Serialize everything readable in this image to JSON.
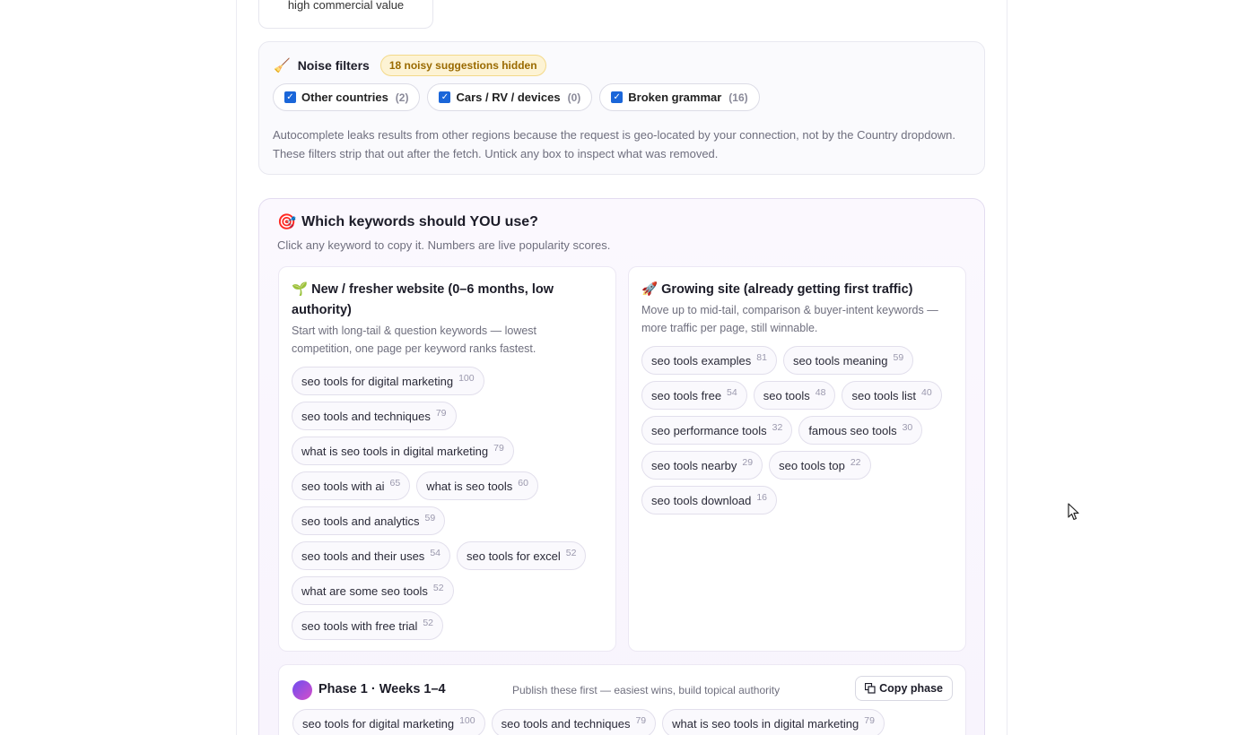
{
  "prev_card": {
    "text": "high commercial value"
  },
  "noise": {
    "icon": "broom-icon",
    "title": "Noise filters",
    "badge": "18 noisy suggestions hidden",
    "filters": [
      {
        "label": "Other countries",
        "count": "(2)",
        "checked": true
      },
      {
        "label": "Cars / RV / devices",
        "count": "(0)",
        "checked": true
      },
      {
        "label": "Broken grammar",
        "count": "(16)",
        "checked": true
      }
    ],
    "note": "Autocomplete leaks results from other regions because the request is geo-located by your connection, not by the Country dropdown. These filters strip that out after the fetch. Untick any box to inspect what was removed."
  },
  "which": {
    "icon": "target-icon",
    "title": "Which keywords should YOU use?",
    "subtitle": "Click any keyword to copy it. Numbers are live popularity scores.",
    "columns": [
      {
        "icon": "seedling-icon",
        "title": "New / fresher website (0–6 months, low authority)",
        "desc": "Start with long-tail & question keywords — lowest competition, one page per keyword ranks fastest.",
        "keywords": [
          {
            "text": "seo tools for digital marketing",
            "score": "100"
          },
          {
            "text": "seo tools and techniques",
            "score": "79"
          },
          {
            "text": "what is seo tools in digital marketing",
            "score": "79"
          },
          {
            "text": "seo tools with ai",
            "score": "65"
          },
          {
            "text": "what is seo tools",
            "score": "60"
          },
          {
            "text": "seo tools and analytics",
            "score": "59"
          },
          {
            "text": "seo tools and their uses",
            "score": "54"
          },
          {
            "text": "seo tools for excel",
            "score": "52"
          },
          {
            "text": "what are some seo tools",
            "score": "52"
          },
          {
            "text": "seo tools with free trial",
            "score": "52"
          }
        ]
      },
      {
        "icon": "rocket-icon",
        "title": "Growing site (already getting first traffic)",
        "desc": "Move up to mid-tail, comparison & buyer-intent keywords — more traffic per page, still winnable.",
        "keywords": [
          {
            "text": "seo tools examples",
            "score": "81"
          },
          {
            "text": "seo tools meaning",
            "score": "59"
          },
          {
            "text": "seo tools free",
            "score": "54"
          },
          {
            "text": "seo tools",
            "score": "48"
          },
          {
            "text": "seo tools list",
            "score": "40"
          },
          {
            "text": "seo performance tools",
            "score": "32"
          },
          {
            "text": "famous seo tools",
            "score": "30"
          },
          {
            "text": "seo tools nearby",
            "score": "29"
          },
          {
            "text": "seo tools top",
            "score": "22"
          },
          {
            "text": "seo tools download",
            "score": "16"
          }
        ]
      }
    ],
    "phase": {
      "title": "Phase 1 · Weeks 1–4",
      "subtitle": "Publish these first — easiest wins, build topical authority",
      "copy_label": "Copy phase",
      "keywords": [
        {
          "text": "seo tools for digital marketing",
          "score": "100"
        },
        {
          "text": "seo tools and techniques",
          "score": "79"
        },
        {
          "text": "what is seo tools in digital marketing",
          "score": "79"
        }
      ]
    }
  }
}
